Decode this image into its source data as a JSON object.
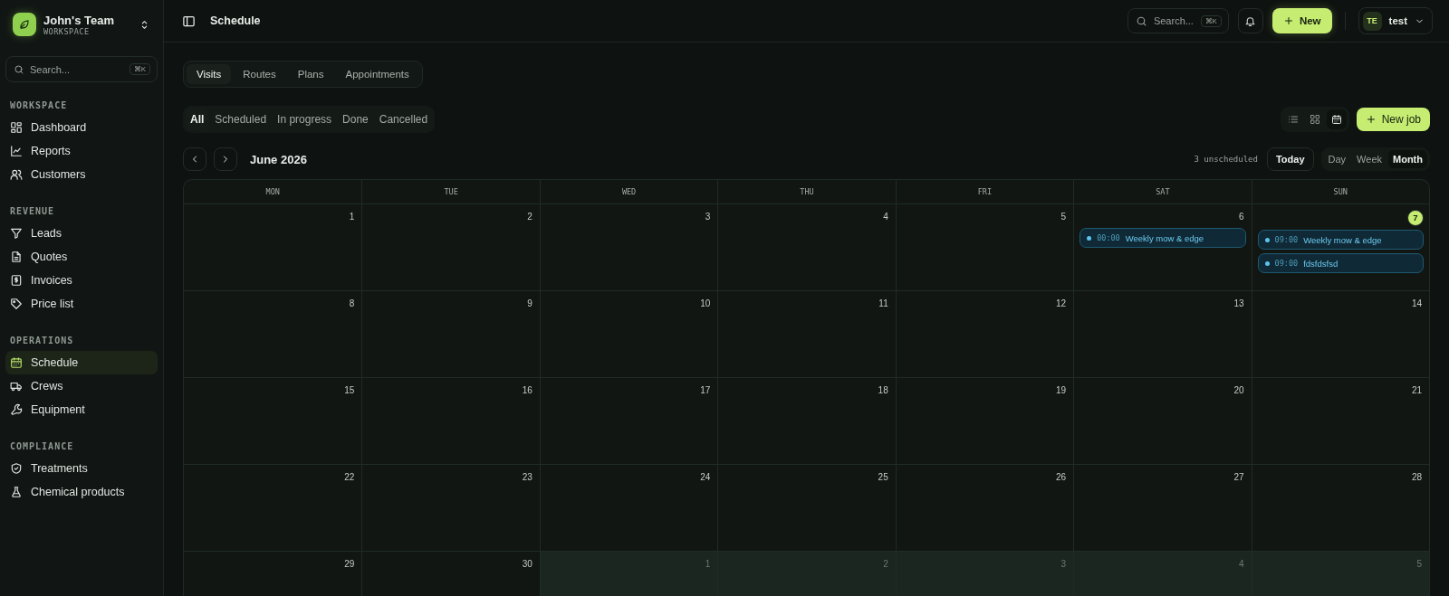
{
  "workspace": {
    "name": "John's Team",
    "subtitle": "WORKSPACE"
  },
  "sidebar": {
    "search": {
      "placeholder": "Search...",
      "shortcut": "⌘K"
    },
    "sections": [
      {
        "title": "WORKSPACE",
        "items": [
          {
            "label": "Dashboard",
            "selected": false
          },
          {
            "label": "Reports",
            "selected": false
          },
          {
            "label": "Customers",
            "selected": false
          }
        ]
      },
      {
        "title": "REVENUE",
        "items": [
          {
            "label": "Leads",
            "selected": false
          },
          {
            "label": "Quotes",
            "selected": false
          },
          {
            "label": "Invoices",
            "selected": false
          },
          {
            "label": "Price list",
            "selected": false
          }
        ]
      },
      {
        "title": "OPERATIONS",
        "items": [
          {
            "label": "Schedule",
            "selected": true
          },
          {
            "label": "Crews",
            "selected": false
          },
          {
            "label": "Equipment",
            "selected": false
          }
        ]
      },
      {
        "title": "COMPLIANCE",
        "items": [
          {
            "label": "Treatments",
            "selected": false
          },
          {
            "label": "Chemical products",
            "selected": false
          }
        ]
      }
    ]
  },
  "header": {
    "title": "Schedule",
    "search": {
      "placeholder": "Search...",
      "shortcut": "⌘K"
    },
    "new_button": "New",
    "user": {
      "initials": "TE",
      "name": "test"
    }
  },
  "tabs": [
    {
      "label": "Visits",
      "selected": true
    },
    {
      "label": "Routes",
      "selected": false
    },
    {
      "label": "Plans",
      "selected": false
    },
    {
      "label": "Appointments",
      "selected": false
    }
  ],
  "filters": [
    {
      "label": "All",
      "selected": true
    },
    {
      "label": "Scheduled",
      "selected": false
    },
    {
      "label": "In progress",
      "selected": false
    },
    {
      "label": "Done",
      "selected": false
    },
    {
      "label": "Cancelled",
      "selected": false
    }
  ],
  "view_modes": [
    {
      "selected": false
    },
    {
      "selected": false
    },
    {
      "selected": true
    }
  ],
  "new_job_button": "New job",
  "calendar": {
    "month": "June 2026",
    "unscheduled": "3 unscheduled",
    "today_button": "Today",
    "ranges": [
      {
        "label": "Day",
        "selected": false
      },
      {
        "label": "Week",
        "selected": false
      },
      {
        "label": "Month",
        "selected": true
      }
    ],
    "weekdays": [
      "MON",
      "TUE",
      "WED",
      "THU",
      "FRI",
      "SAT",
      "SUN"
    ],
    "weeks": [
      [
        {
          "day": "1",
          "outside_month": false,
          "today": false
        },
        {
          "day": "2",
          "outside_month": false,
          "today": false
        },
        {
          "day": "3",
          "outside_month": false,
          "today": false
        },
        {
          "day": "4",
          "outside_month": false,
          "today": false
        },
        {
          "day": "5",
          "outside_month": false,
          "today": false
        },
        {
          "day": "6",
          "outside_month": false,
          "today": false,
          "events": [
            {
              "time": "00:00",
              "title": "Weekly mow & edge"
            }
          ]
        },
        {
          "day": "7",
          "outside_month": false,
          "today": true,
          "events": [
            {
              "time": "09:00",
              "title": "Weekly mow & edge"
            },
            {
              "time": "09:00",
              "title": "fdsfdsfsd"
            }
          ]
        }
      ],
      [
        {
          "day": "8",
          "outside_month": false,
          "today": false
        },
        {
          "day": "9",
          "outside_month": false,
          "today": false
        },
        {
          "day": "10",
          "outside_month": false,
          "today": false
        },
        {
          "day": "11",
          "outside_month": false,
          "today": false
        },
        {
          "day": "12",
          "outside_month": false,
          "today": false
        },
        {
          "day": "13",
          "outside_month": false,
          "today": false
        },
        {
          "day": "14",
          "outside_month": false,
          "today": false
        }
      ],
      [
        {
          "day": "15",
          "outside_month": false,
          "today": false
        },
        {
          "day": "16",
          "outside_month": false,
          "today": false
        },
        {
          "day": "17",
          "outside_month": false,
          "today": false
        },
        {
          "day": "18",
          "outside_month": false,
          "today": false
        },
        {
          "day": "19",
          "outside_month": false,
          "today": false
        },
        {
          "day": "20",
          "outside_month": false,
          "today": false
        },
        {
          "day": "21",
          "outside_month": false,
          "today": false
        }
      ],
      [
        {
          "day": "22",
          "outside_month": false,
          "today": false
        },
        {
          "day": "23",
          "outside_month": false,
          "today": false
        },
        {
          "day": "24",
          "outside_month": false,
          "today": false
        },
        {
          "day": "25",
          "outside_month": false,
          "today": false
        },
        {
          "day": "26",
          "outside_month": false,
          "today": false
        },
        {
          "day": "27",
          "outside_month": false,
          "today": false
        },
        {
          "day": "28",
          "outside_month": false,
          "today": false
        }
      ],
      [
        {
          "day": "29",
          "outside_month": false,
          "today": false
        },
        {
          "day": "30",
          "outside_month": false,
          "today": false
        },
        {
          "day": "1",
          "outside_month": true,
          "today": false
        },
        {
          "day": "2",
          "outside_month": true,
          "today": false
        },
        {
          "day": "3",
          "outside_month": true,
          "today": false
        },
        {
          "day": "4",
          "outside_month": true,
          "today": false
        },
        {
          "day": "5",
          "outside_month": true,
          "today": false
        }
      ]
    ]
  }
}
